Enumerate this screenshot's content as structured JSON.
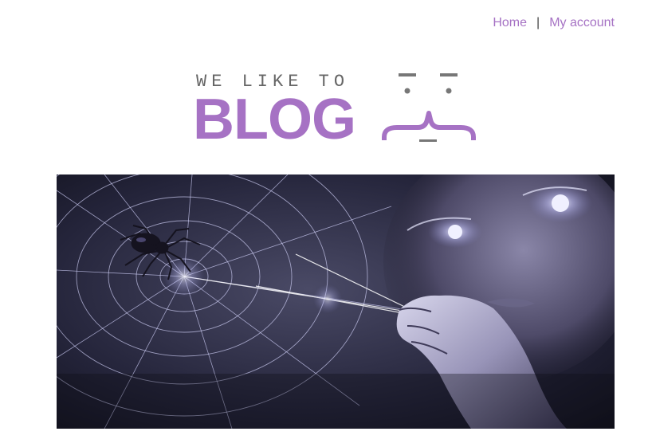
{
  "nav": {
    "home_label": "Home",
    "separator": "|",
    "account_label": "My account"
  },
  "logo": {
    "tagline": "WE LIKE TO",
    "wordmark": "BLOG"
  },
  "colors": {
    "brand_purple": "#a672c4",
    "tagline_gray": "#666666",
    "face_gray": "#777777"
  },
  "banner": {
    "description_icon": "spider-web-banner-image"
  }
}
